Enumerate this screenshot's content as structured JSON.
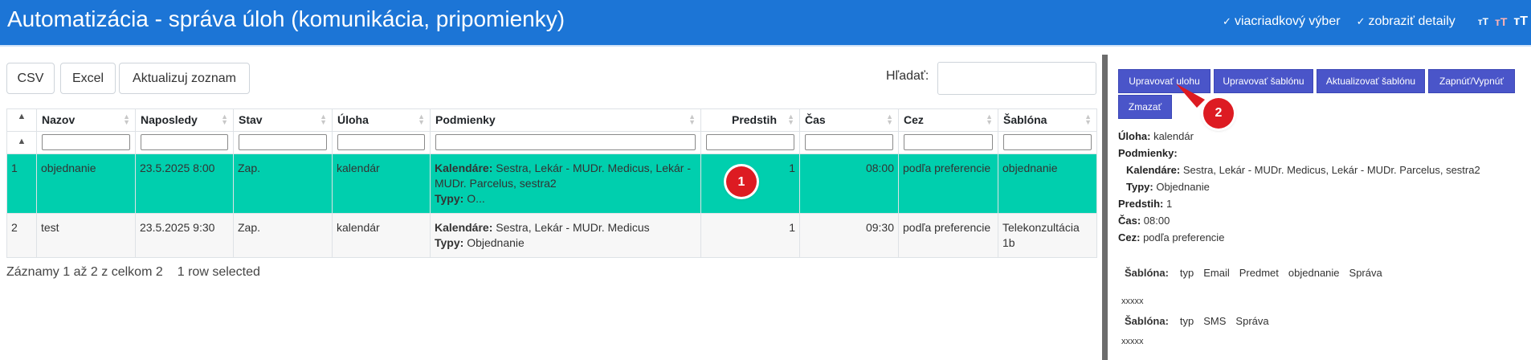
{
  "header": {
    "title": "Automatizácia - správa úloh (komunikácia, pripomienky)",
    "options": [
      {
        "check": "✓",
        "label": "viacriadkový výber"
      },
      {
        "check": "✓",
        "label": "zobraziť detaily"
      }
    ],
    "font_size_icons": [
      "тT",
      "тT",
      "тT"
    ]
  },
  "toolbar": {
    "csv": "CSV",
    "excel": "Excel",
    "refresh": "Aktualizuj zoznam"
  },
  "search": {
    "label": "Hľadať:",
    "value": ""
  },
  "table": {
    "index_sort": "▲",
    "columns": [
      "Nazov",
      "Naposledy",
      "Stav",
      "Úloha",
      "Podmienky",
      "Predstih",
      "Čas",
      "Cez",
      "Šablóna"
    ],
    "rows": [
      {
        "idx": "1",
        "nazov": "objednanie",
        "naposledy": "23.5.2025 8:00",
        "stav": "Zap.",
        "uloha": "kalendár",
        "cond_label1": "Kalendáre:",
        "cond_text1": " Sestra, Lekár - MUDr. Medicus, Lekár - MUDr. Parcelus, sestra2",
        "cond_label2": "Typy:",
        "cond_text2": " O...",
        "predstih": "1",
        "cas": "08:00",
        "cez": "podľa preferencie",
        "sablona": "objednanie"
      },
      {
        "idx": "2",
        "nazov": "test",
        "naposledy": "23.5.2025 9:30",
        "stav": "Zap.",
        "uloha": "kalendár",
        "cond_label1": "Kalendáre:",
        "cond_text1": " Sestra, Lekár - MUDr. Medicus",
        "cond_label2": "Typy:",
        "cond_text2": " Objednanie",
        "predstih": "1",
        "cas": "09:30",
        "cez": "podľa preferencie",
        "sablona": "Telekonzultácia 1b"
      }
    ]
  },
  "info": {
    "records": "Záznamy 1 až 2 z celkom 2",
    "selected": "1 row selected"
  },
  "markers": {
    "one": "1",
    "two": "2"
  },
  "panel": {
    "buttons": {
      "edit_task": "Upravovať ulohu",
      "edit_template": "Upravovať šablónu",
      "update_template": "Aktualizovať šablónu",
      "toggle": "Zapnúť/Vypnúť",
      "delete": "Zmazať"
    },
    "details": {
      "uloha_label": "Úloha:",
      "uloha_value": " kalendár",
      "podmienky_label": "Podmienky:",
      "kalendare_label": "Kalendáre:",
      "kalendare_value": " Sestra, Lekár - MUDr. Medicus, Lekár - MUDr. Parcelus, sestra2",
      "typy_label": "Typy:",
      "typy_value": " Objednanie",
      "predstih_label": "Predstih:",
      "predstih_value": " 1",
      "cas_label": "Čas:",
      "cas_value": " 08:00",
      "cez_label": "Cez:",
      "cez_value": " podľa preferencie"
    },
    "templates": [
      {
        "label": "Šablóna:",
        "fields": [
          "typ",
          "Email",
          "Predmet",
          "objednanie",
          "Správa"
        ],
        "note": "xxxxx"
      },
      {
        "label": "Šablóna:",
        "fields": [
          "typ",
          "SMS",
          "Správa"
        ],
        "note": "xxxxx"
      }
    ]
  },
  "colors": {
    "header_bg": "#1c75d6",
    "selected_row": "#00cfae",
    "panel_button": "#4a55c9",
    "marker": "#dd1b22"
  }
}
